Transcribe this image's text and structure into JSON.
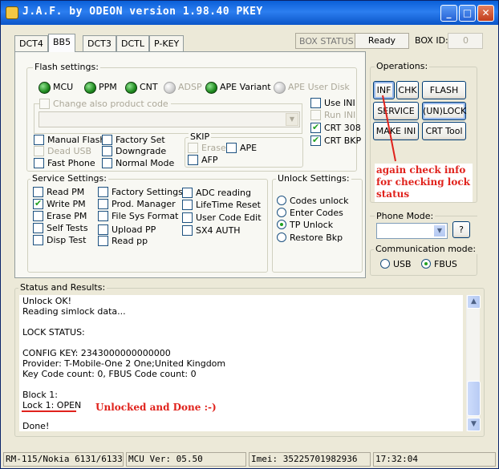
{
  "window": {
    "title": "J.A.F. by ODEON version 1.98.40 PKEY",
    "min_label": "_",
    "max_label": "□",
    "close_label": "✕"
  },
  "tabs": [
    "DCT4",
    "BB5",
    "DCT3",
    "DCTL",
    "P-KEY"
  ],
  "active_tab": "BB5",
  "box_status": {
    "label": "BOX STATUS:",
    "value": "Ready",
    "id_label": "BOX ID:",
    "id_value": "0"
  },
  "flash_settings": {
    "label": "Flash settings:",
    "leds": [
      {
        "label": "MCU",
        "on": true
      },
      {
        "label": "PPM",
        "on": true
      },
      {
        "label": "CNT",
        "on": true
      },
      {
        "label": "ADSP",
        "on": false
      },
      {
        "label": "APE Variant",
        "on": true
      },
      {
        "label": "APE User Disk",
        "on": false
      }
    ],
    "change_product_code": "Change also product code",
    "right_checks": [
      "Use INI",
      "Run INI",
      "CRT 308",
      "CRT BKP"
    ],
    "left_checks": [
      "Manual Flash",
      "Dead USB",
      "Fast Phone"
    ],
    "mid_checks": [
      "Factory Set",
      "Downgrade",
      "Normal Mode"
    ],
    "skip": {
      "label": "SKIP",
      "items": [
        "Erase",
        "APE",
        "AFP"
      ]
    }
  },
  "service_settings": {
    "label": "Service Settings:",
    "col1": [
      "Read PM",
      "Write PM",
      "Erase PM",
      "Self Tests",
      "Disp Test"
    ],
    "col2": [
      "Factory Settings",
      "Prod. Manager",
      "File Sys Format",
      "Upload PP",
      "Read pp"
    ],
    "col3": [
      "ADC reading",
      "LifeTime Reset",
      "User Code Edit",
      "SX4 AUTH"
    ]
  },
  "unlock_settings": {
    "label": "Unlock Settings:",
    "options": [
      "Codes unlock",
      "Enter Codes",
      "TP Unlock",
      "Restore Bkp"
    ],
    "selected": "TP Unlock"
  },
  "operations": {
    "label": "Operations:",
    "buttons": [
      "INF",
      "CHK",
      "FLASH",
      "SERVICE",
      "(UN)LOCK",
      "MAKE INI",
      "CRT Tool"
    ]
  },
  "phone_mode": {
    "label": "Phone Mode:",
    "help": "?"
  },
  "communication_mode": {
    "label": "Communication mode:",
    "options": [
      "USB",
      "FBUS"
    ],
    "selected": "FBUS"
  },
  "status_results": {
    "label": "Status and Results:",
    "lines": [
      "Unlock OK!",
      "Reading simlock data...",
      "",
      "LOCK STATUS:",
      "",
      "CONFIG KEY: 2343000000000000",
      "Provider: T-Mobile-One 2 One;United Kingdom",
      "Key Code count: 0, FBUS Code count: 0",
      "",
      "Block 1:",
      "Lock 1: OPEN",
      "",
      "Done!"
    ]
  },
  "annotations": {
    "check_info": [
      "again check info",
      "for checking lock",
      "status"
    ],
    "unlocked": "Unlocked and Done :-)",
    "accent_color": "#e0221c"
  },
  "statusbar": {
    "model": "RM-115/Nokia 6131/6133",
    "mcu": "MCU Ver: 05.50",
    "imei": "Imei: 35225701982936",
    "time": "17:32:04"
  }
}
